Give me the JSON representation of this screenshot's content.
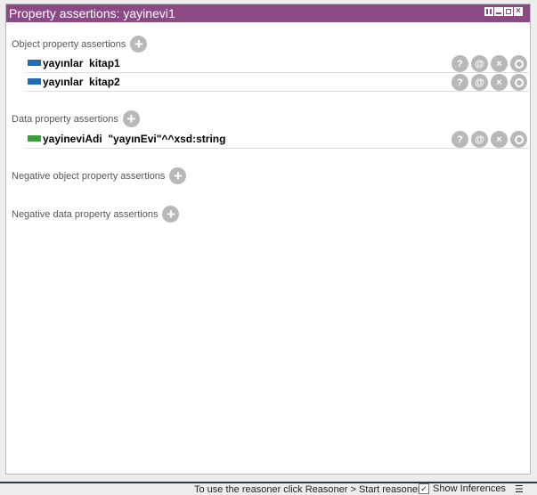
{
  "window": {
    "title": "Property assertions: yayinevi1"
  },
  "sections": {
    "object_props": {
      "label": "Object property assertions",
      "rows": [
        {
          "text": "yayınlar  kitap1"
        },
        {
          "text": "yayınlar  kitap2"
        }
      ]
    },
    "data_props": {
      "label": "Data property assertions",
      "rows": [
        {
          "text": "yayineviAdi  \"yayınEvi\"^^xsd:string"
        }
      ]
    },
    "neg_object_props": {
      "label": "Negative object property assertions"
    },
    "neg_data_props": {
      "label": "Negative data property assertions"
    }
  },
  "row_buttons": {
    "explain": "?",
    "annotate": "@",
    "delete": "×"
  },
  "status": {
    "message": "To use the reasoner click Reasoner > Start reasoner",
    "show_inferences": "Show Inferences",
    "show_inferences_checked": true
  },
  "colors": {
    "title_bar": "#8a4a84",
    "object_property": "#1e6fb5",
    "data_property": "#3d9c3f"
  },
  "icons": {
    "add": "plus-icon",
    "menu": "menu-icon"
  }
}
